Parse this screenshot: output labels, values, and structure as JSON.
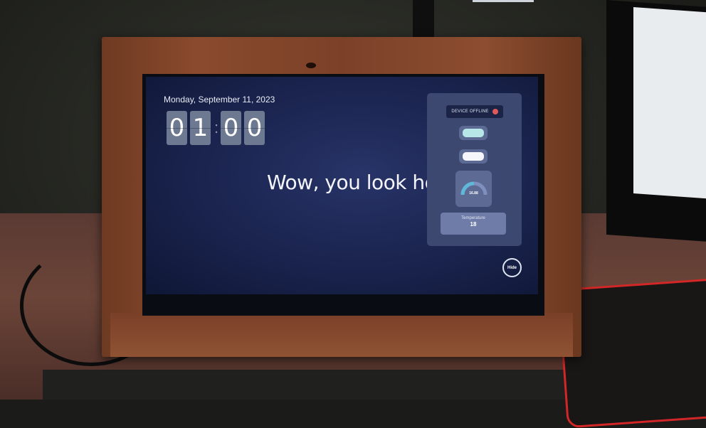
{
  "screen": {
    "date": "Monday, September 11, 2023",
    "clock": {
      "digits": [
        "0",
        "1",
        "0",
        "0"
      ],
      "separator": ":"
    },
    "message": "Wow, you look hot!",
    "panel": {
      "status_label": "DEVICE OFFLINE",
      "status_color": "#e05a5a",
      "pill_1_color": "#b7e7e6",
      "pill_2_color": "#f4f6fa",
      "gauge_value": "16.88",
      "gauge_colors": [
        "#5fb8d8",
        "#7f8fbf"
      ],
      "temperature_label": "Temperature",
      "temperature_value": "18"
    },
    "hide_label": "Hide"
  },
  "colors": {
    "screen_bg": "#1c2652",
    "panel_bg": "#3c4870",
    "frame_wood": "#7b4128"
  }
}
